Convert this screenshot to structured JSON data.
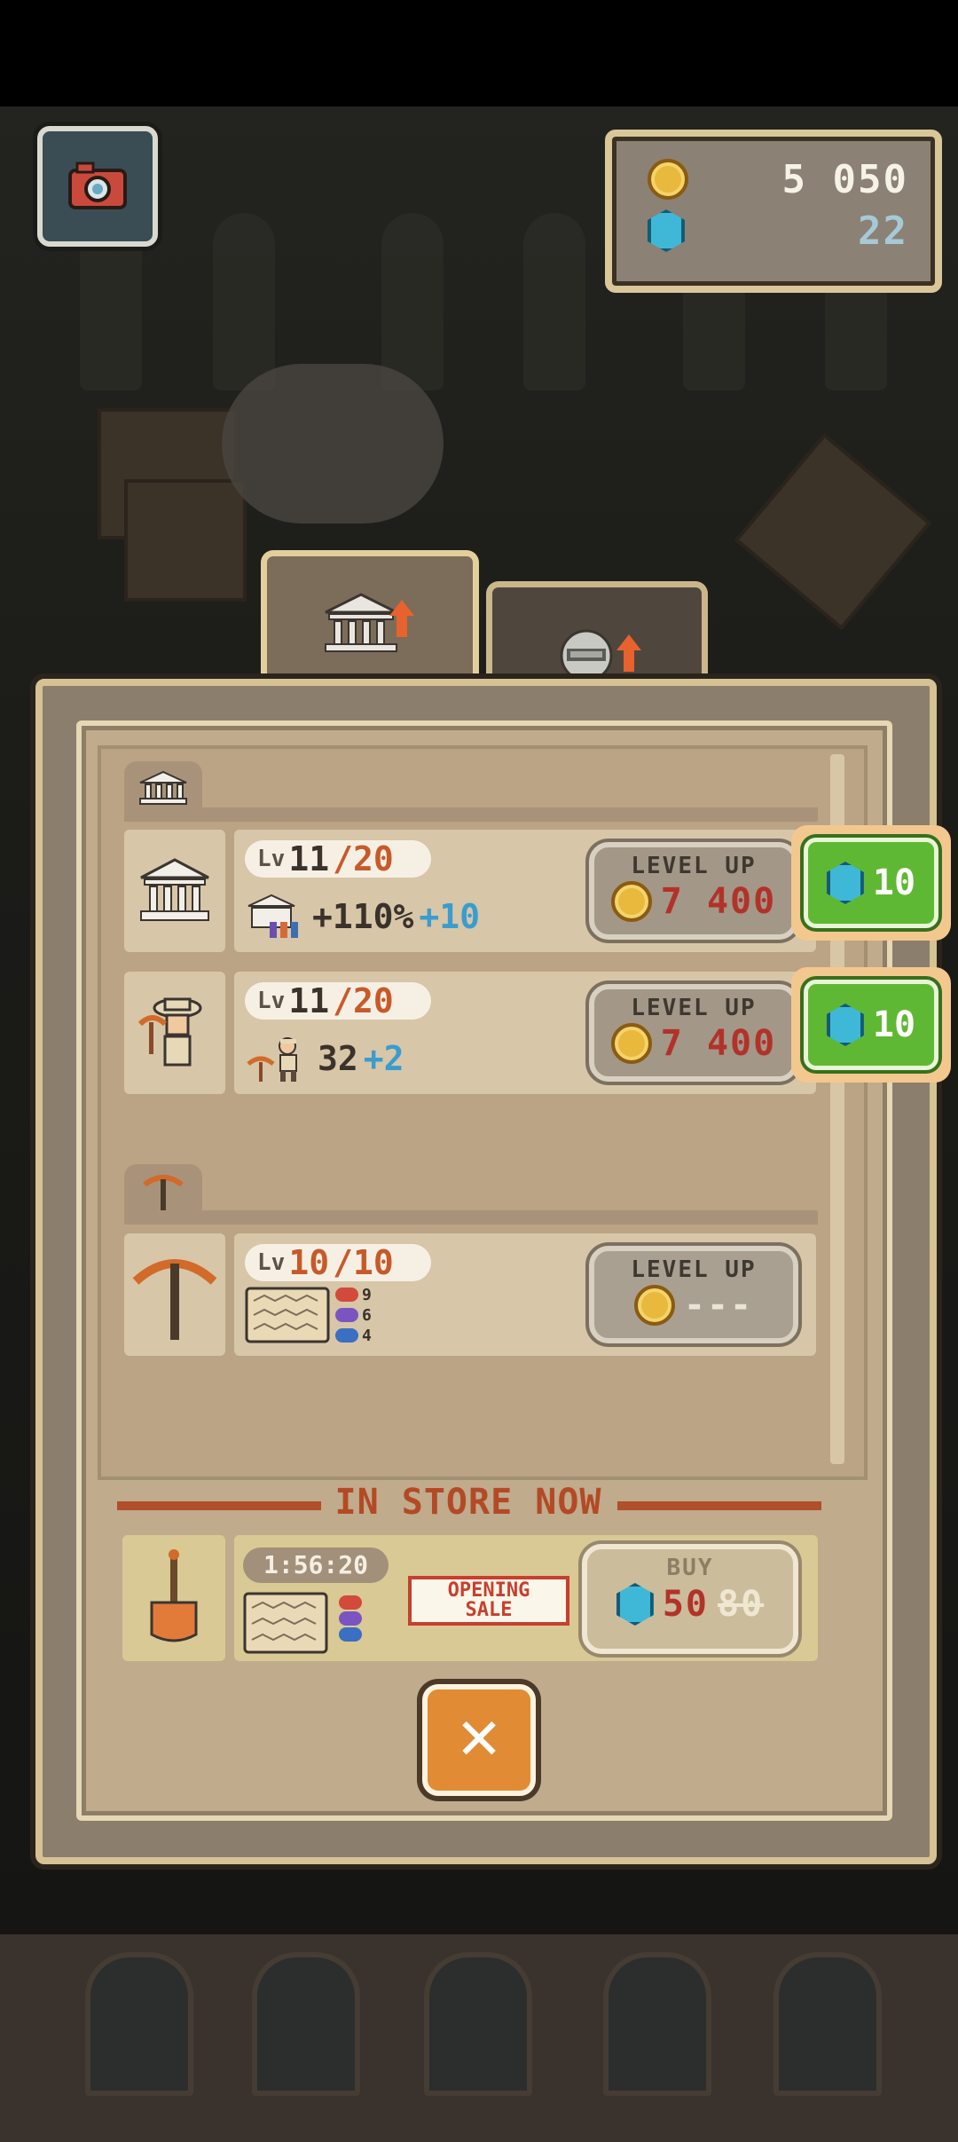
{
  "currency": {
    "coins": "5 050",
    "gems": "22"
  },
  "tabs": [
    {
      "name": "museum-upgrades"
    },
    {
      "name": "robot-upgrades"
    }
  ],
  "museum_section": {
    "rows": [
      {
        "level": "11",
        "max": "/20",
        "stat_value": "+110%",
        "stat_bonus": "+10",
        "button_label": "LEVEL UP",
        "coin_cost": "7 400",
        "gem_cost": "10"
      },
      {
        "level": "11",
        "max": "/20",
        "stat_value": "32",
        "stat_bonus": "+2",
        "button_label": "LEVEL UP",
        "coin_cost": "7 400",
        "gem_cost": "10"
      }
    ]
  },
  "pickaxe_section": {
    "rows": [
      {
        "lv_label": "Lv",
        "level": "10",
        "max": "/10",
        "counts": [
          "9",
          "6",
          "4"
        ],
        "button_label": "LEVEL UP",
        "coin_cost": "---"
      }
    ]
  },
  "store": {
    "title": "IN STORE NOW",
    "timer": "1:56:20",
    "sale_line1": "OPENING",
    "sale_line2": "SALE",
    "buy_label": "BUY",
    "price": "50",
    "old_price": "80"
  },
  "lv_label": "Lv",
  "colors": {
    "accent_orange": "#e28b35",
    "gem_green": "#5fb833",
    "cost_red": "#b2322a",
    "bonus_blue": "#3a9ccf"
  }
}
